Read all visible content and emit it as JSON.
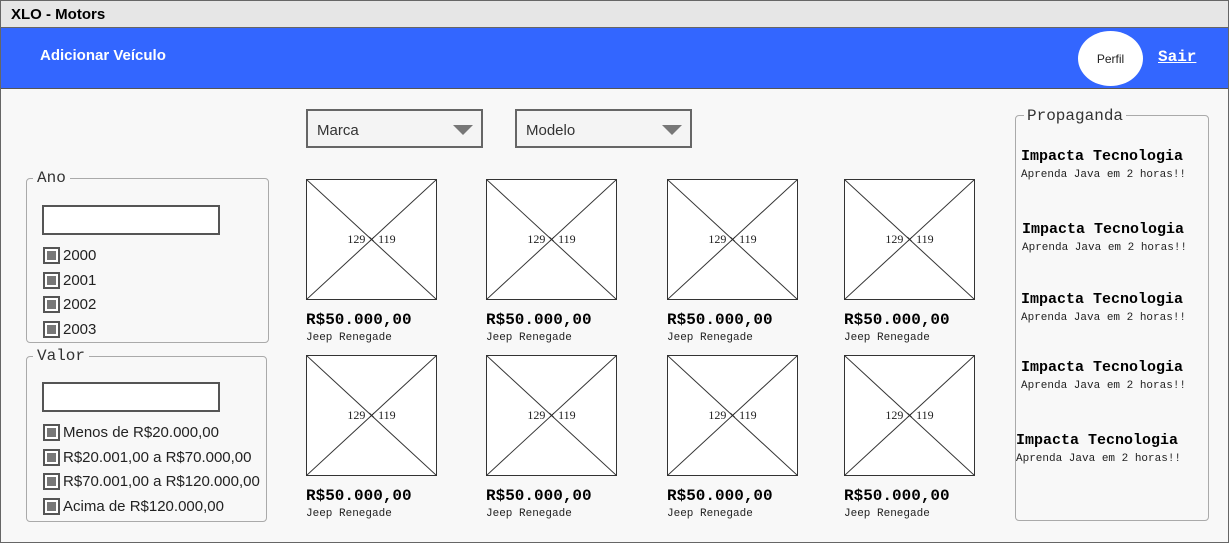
{
  "window": {
    "title": "XLO - Motors"
  },
  "navbar": {
    "add_vehicle": "Adicionar Veículo",
    "profile": "Perfil",
    "logout": "Sair",
    "color": "#3366ff"
  },
  "filters": {
    "brand": {
      "selected": "Marca"
    },
    "model": {
      "selected": "Modelo"
    }
  },
  "year_group": {
    "legend": "Ano",
    "input_value": "",
    "options": [
      "2000",
      "2001",
      "2002",
      "2003"
    ]
  },
  "price_group": {
    "legend": "Valor",
    "input_value": "",
    "options": [
      "Menos de R$20.000,00",
      "R$20.001,00 a R$70.000,00",
      "R$70.001,00 a R$120.000,00",
      "Acima de R$120.000,00"
    ]
  },
  "products": [
    {
      "image_label": "129 × 119",
      "price": "R$50.000,00",
      "name": "Jeep Renegade"
    },
    {
      "image_label": "129 × 119",
      "price": "R$50.000,00",
      "name": "Jeep Renegade"
    },
    {
      "image_label": "129 × 119",
      "price": "R$50.000,00",
      "name": "Jeep Renegade"
    },
    {
      "image_label": "129 × 119",
      "price": "R$50.000,00",
      "name": "Jeep Renegade"
    },
    {
      "image_label": "129 × 119",
      "price": "R$50.000,00",
      "name": "Jeep Renegade"
    },
    {
      "image_label": "129 × 119",
      "price": "R$50.000,00",
      "name": "Jeep Renegade"
    },
    {
      "image_label": "129 × 119",
      "price": "R$50.000,00",
      "name": "Jeep Renegade"
    },
    {
      "image_label": "129 × 119",
      "price": "R$50.000,00",
      "name": "Jeep Renegade"
    }
  ],
  "ads": {
    "title": "Propaganda",
    "items": [
      {
        "headline": "Impacta Tecnologia",
        "text": "Aprenda Java em 2 horas!!"
      },
      {
        "headline": "Impacta Tecnologia",
        "text": "Aprenda Java em 2 horas!!"
      },
      {
        "headline": "Impacta Tecnologia",
        "text": "Aprenda Java em 2 horas!!"
      },
      {
        "headline": "Impacta Tecnologia",
        "text": "Aprenda Java em 2 horas!!"
      },
      {
        "headline": "Impacta Tecnologia",
        "text": "Aprenda Java em 2 horas!!"
      }
    ]
  }
}
